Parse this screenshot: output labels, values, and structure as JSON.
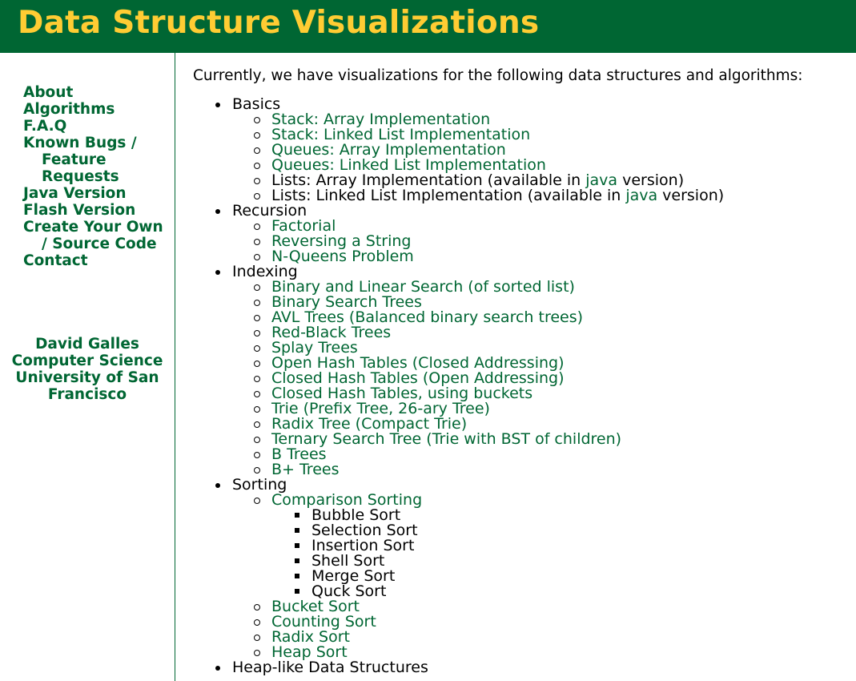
{
  "header": {
    "title": "Data Structure Visualizations"
  },
  "sidebar": {
    "nav": [
      "About",
      "Algorithms",
      "F.A.Q",
      "Known Bugs / Feature Requests",
      "Java Version",
      "Flash Version",
      "Create Your Own / Source Code",
      "Contact"
    ],
    "author": [
      "David Galles",
      "Computer Science",
      "University of San Francisco"
    ]
  },
  "content": {
    "intro": "Currently, we have visualizations for the following data structures and algorithms:",
    "basics": {
      "label": "Basics",
      "stack_array": "Stack: Array Implementation",
      "stack_list": "Stack: Linked List Implementation",
      "queue_array": "Queues: Array Implementation",
      "queue_list": "Queues: Linked List Implementation",
      "lists_array_prefix": "Lists: Array Implementation (available in ",
      "lists_list_prefix": "Lists: Linked List Implementation (available in ",
      "java_link": "java",
      "version_suffix": " version)"
    },
    "recursion": {
      "label": "Recursion",
      "items": [
        "Factorial",
        "Reversing a String",
        "N-Queens Problem"
      ]
    },
    "indexing": {
      "label": "Indexing",
      "items": [
        "Binary and Linear Search (of sorted list)",
        "Binary Search Trees",
        "AVL Trees (Balanced binary search trees)",
        "Red-Black Trees",
        "Splay Trees",
        "Open Hash Tables (Closed Addressing)",
        "Closed Hash Tables (Open Addressing)",
        "Closed Hash Tables, using buckets",
        "Trie (Prefix Tree, 26-ary Tree)",
        "Radix Tree (Compact Trie)",
        "Ternary Search Tree (Trie with BST of children)",
        "B Trees",
        "B+ Trees"
      ]
    },
    "sorting": {
      "label": "Sorting",
      "comparison": "Comparison Sorting",
      "comparison_items": [
        "Bubble Sort",
        "Selection Sort",
        "Insertion Sort",
        "Shell Sort",
        "Merge Sort",
        "Quck Sort"
      ],
      "other": [
        "Bucket Sort",
        "Counting Sort",
        "Radix Sort",
        "Heap Sort"
      ]
    },
    "heap": {
      "label": "Heap-like Data Structures"
    }
  },
  "colors": {
    "header_bg": "#006633",
    "title": "#ffcc33",
    "link": "#006633"
  }
}
